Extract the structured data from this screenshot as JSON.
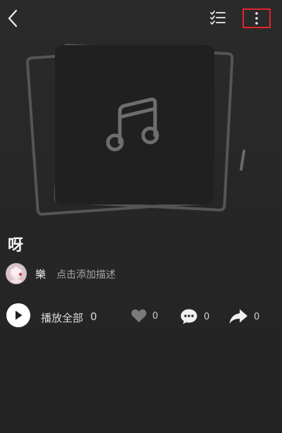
{
  "header": {
    "back_icon": "chevron-left-icon",
    "list_icon": "checklist-icon",
    "more_icon": "vertical-ellipsis-icon",
    "highlight_color": "#e0262e"
  },
  "playlist": {
    "cover_icon": "music-note-icon",
    "title": "呀",
    "creator_name": "樂",
    "description_placeholder": "点击添加描述"
  },
  "actions": {
    "play_all_label": "播放全部",
    "play_all_count": "0",
    "like_count": "0",
    "comment_count": "0",
    "share_count": "0"
  }
}
